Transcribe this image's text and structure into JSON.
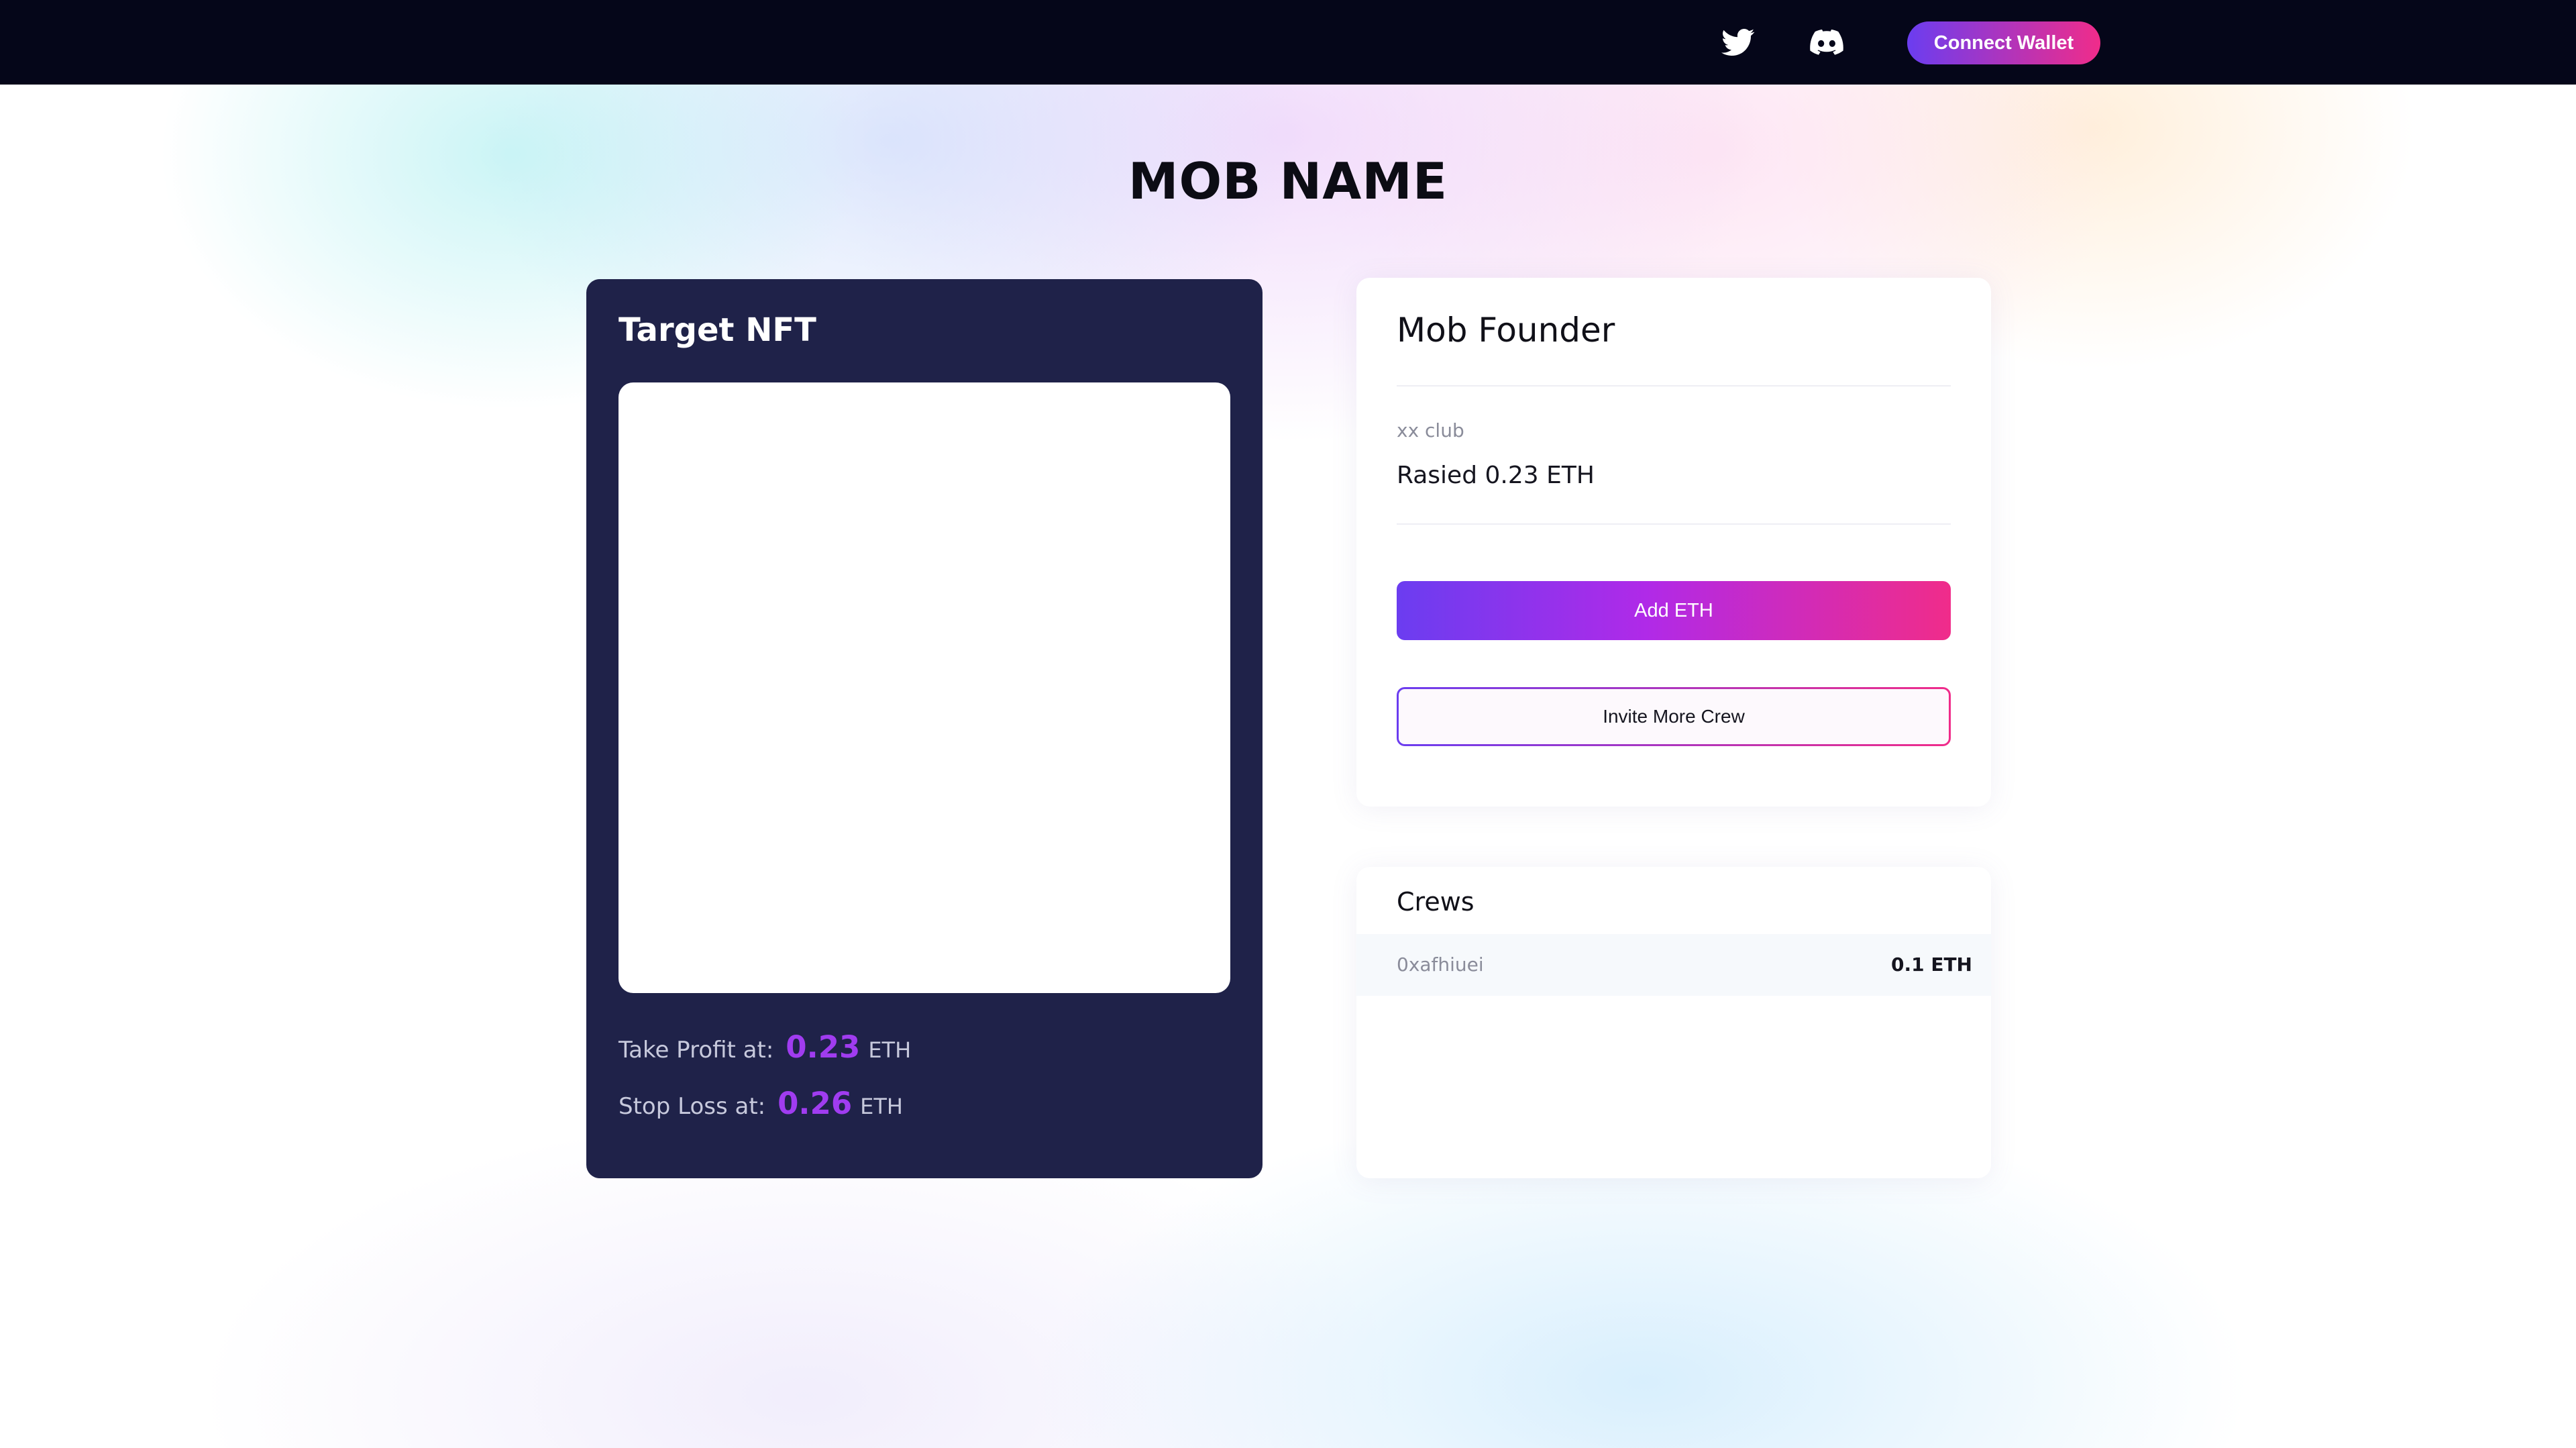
{
  "theme": {
    "gradient_start": "#6b3df0",
    "gradient_mid": "#b02ae8",
    "gradient_end": "#f02c8a",
    "nav_bg": "#050619",
    "card_dark": "#1f2249",
    "accent_value": "#a03cf0"
  },
  "nav": {
    "icons": [
      "twitter-icon",
      "discord-icon"
    ],
    "connect_label": "Connect Wallet"
  },
  "page": {
    "title": "MOB NAME"
  },
  "target_nft": {
    "title": "Target NFT",
    "take_profit": {
      "label": "Take Profit at:",
      "value": "0.23",
      "unit": "ETH"
    },
    "stop_loss": {
      "label": "Stop Loss at:",
      "value": "0.26",
      "unit": "ETH"
    }
  },
  "founder": {
    "title": "Mob Founder",
    "club": "xx club",
    "raised": "Rasied 0.23 ETH",
    "add_eth_label": "Add ETH",
    "invite_label": "Invite More Crew"
  },
  "crews": {
    "title": "Crews",
    "rows": [
      {
        "address": "0xafhiuei",
        "amount": "0.1 ETH"
      }
    ]
  }
}
